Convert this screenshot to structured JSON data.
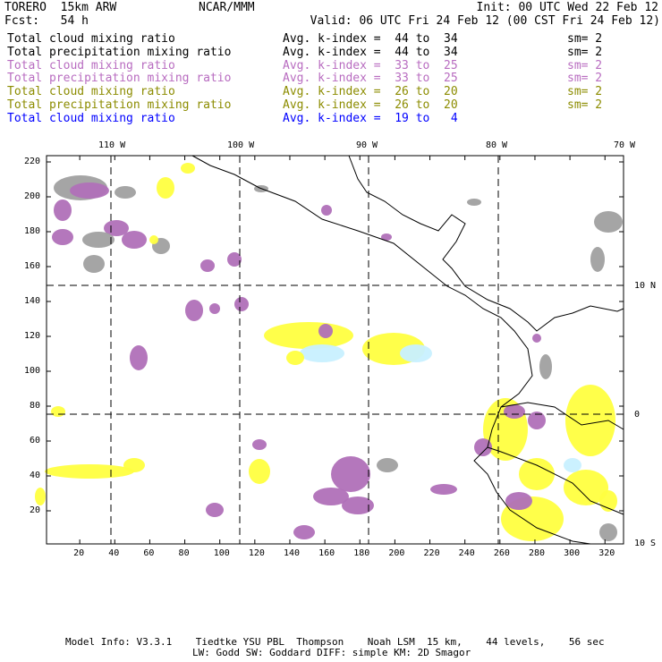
{
  "header": {
    "title": "TORERO  15km ARW",
    "org": "NCAR/MMM",
    "init": "Init: 00 UTC Wed 22 Feb 12",
    "fcst": "Fcst:   54 h",
    "valid": "Valid: 06 UTC Fri 24 Feb 12 (00 CST Fri 24 Feb 12)"
  },
  "legend": [
    {
      "field": "Total cloud mixing ratio",
      "range": "Avg. k-index =  44 to  34",
      "sm": "sm= 2",
      "color": "#000000"
    },
    {
      "field": "Total precipitation mixing ratio",
      "range": "Avg. k-index =  44 to  34",
      "sm": "sm= 2",
      "color": "#000000"
    },
    {
      "field": "Total cloud mixing ratio",
      "range": "Avg. k-index =  33 to  25",
      "sm": "sm= 2",
      "color": "#b86cc0"
    },
    {
      "field": "Total precipitation mixing ratio",
      "range": "Avg. k-index =  33 to  25",
      "sm": "sm= 2",
      "color": "#b86cc0"
    },
    {
      "field": "Total cloud mixing ratio",
      "range": "Avg. k-index =  26 to  20",
      "sm": "sm= 2",
      "color": "#8c8c00"
    },
    {
      "field": "Total precipitation mixing ratio",
      "range": "Avg. k-index =  26 to  20",
      "sm": "sm= 2",
      "color": "#8c8c00"
    },
    {
      "field": "Total cloud mixing ratio",
      "range": "Avg. k-index =  19 to   4",
      "sm": "",
      "color": "#0000ff"
    }
  ],
  "map": {
    "lon_labels": [
      "110 W",
      "100 W",
      "90 W",
      "80 W",
      "70 W"
    ],
    "lat_labels": [
      "10 N",
      "0",
      "10 S"
    ],
    "x_ticks": [
      "20",
      "40",
      "60",
      "80",
      "100",
      "120",
      "140",
      "160",
      "180",
      "200",
      "220",
      "240",
      "260",
      "280",
      "300",
      "320"
    ],
    "y_ticks": [
      "220",
      "200",
      "180",
      "160",
      "140",
      "120",
      "100",
      "80",
      "60",
      "40",
      "20"
    ]
  },
  "footer": {
    "line1": "Model Info: V3.3.1    Tiedtke YSU PBL  Thompson    Noah LSM  15 km,    44 levels,    56 sec",
    "line2": "LW: Godd SW: Goddard DIFF: simple KM: 2D Smagor"
  }
}
